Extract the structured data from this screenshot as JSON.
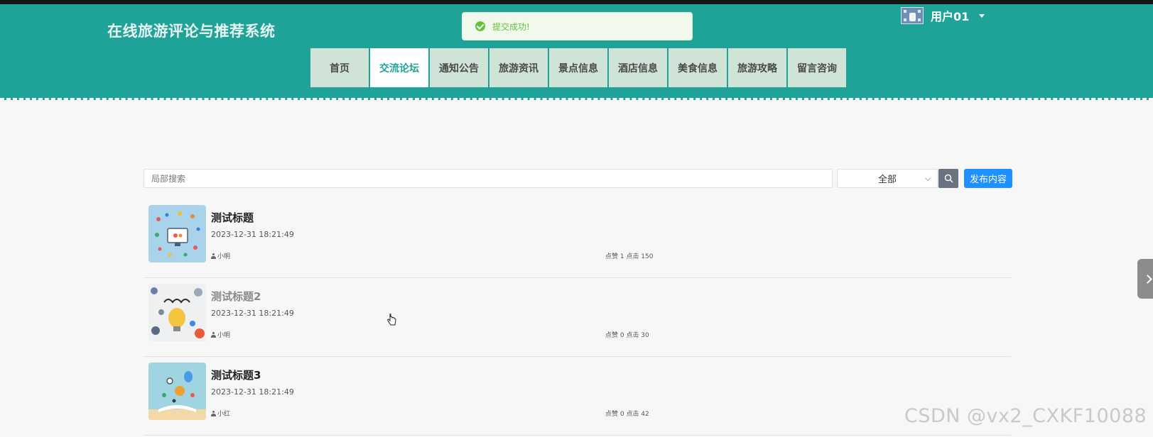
{
  "site": {
    "title": "在线旅游评论与推荐系统"
  },
  "toast": {
    "message": "提交成功!"
  },
  "user": {
    "name": "用户01"
  },
  "nav": {
    "items": [
      {
        "label": "首页"
      },
      {
        "label": "交流论坛",
        "active": true
      },
      {
        "label": "通知公告"
      },
      {
        "label": "旅游资讯"
      },
      {
        "label": "景点信息"
      },
      {
        "label": "酒店信息"
      },
      {
        "label": "美食信息"
      },
      {
        "label": "旅游攻略"
      },
      {
        "label": "留言咨询"
      }
    ]
  },
  "search": {
    "placeholder": "局部搜索",
    "category_selected": "全部",
    "publish_label": "发布内容"
  },
  "posts": [
    {
      "title": "测试标题",
      "date": "2023-12-31 18:21:49",
      "author": "小明",
      "stats": "点赞 1 点击 150"
    },
    {
      "title": "测试标题2",
      "date": "2023-12-31 18:21:49",
      "author": "小明",
      "stats": "点赞 0 点击 30"
    },
    {
      "title": "测试标题3",
      "date": "2023-12-31 18:21:49",
      "author": "小红",
      "stats": "点赞 0 点击 42"
    }
  ],
  "watermark": "CSDN @vx2_CXKF10088",
  "colors": {
    "header": "#1fa399",
    "nav_item": "#cfe4d6",
    "accent": "#1e90ff",
    "success": "#67c23a"
  }
}
